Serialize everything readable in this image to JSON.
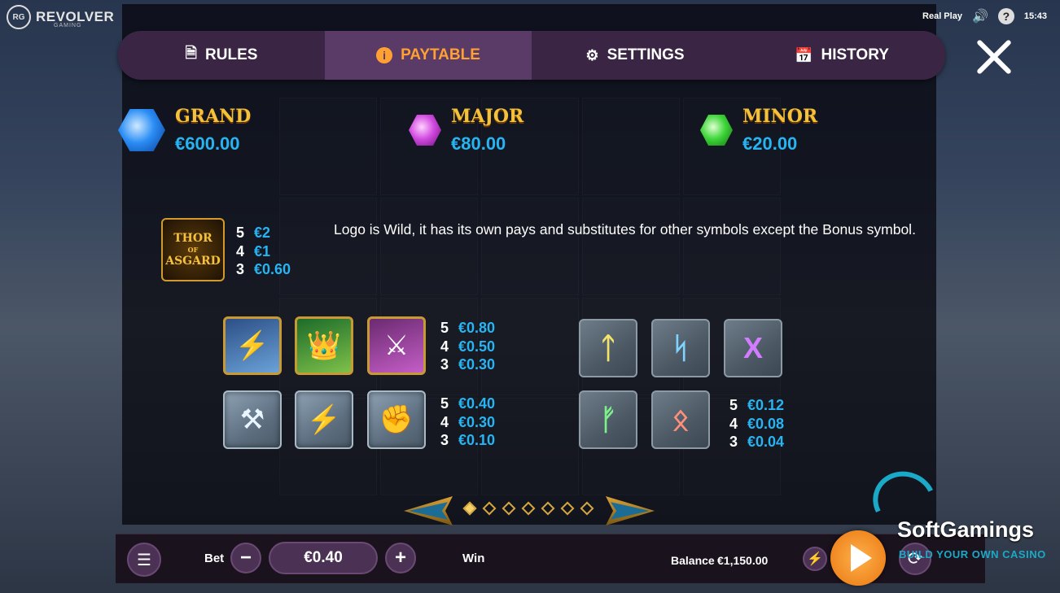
{
  "brand": {
    "logo_mark": "RG",
    "name": "REVOLVER",
    "sub": "GAMING"
  },
  "status": {
    "mode": "Real Play",
    "time": "15:43",
    "help": "?"
  },
  "tabs": [
    {
      "label": "RULES",
      "icon": "document-icon",
      "active": false
    },
    {
      "label": "PAYTABLE",
      "icon": "info-icon",
      "active": true
    },
    {
      "label": "SETTINGS",
      "icon": "gear-icon",
      "active": false
    },
    {
      "label": "HISTORY",
      "icon": "calendar-icon",
      "active": false
    }
  ],
  "jackpots": [
    {
      "name": "GRAND",
      "value": "€600.00",
      "color": "#2a8df5"
    },
    {
      "name": "MAJOR",
      "value": "€80.00",
      "color": "#d24be0"
    },
    {
      "name": "MINOR",
      "value": "€20.00",
      "color": "#3ed63a"
    }
  ],
  "wild": {
    "logo_lines": [
      "THOR",
      "OF",
      "ASGARD"
    ],
    "pays": [
      {
        "count": "5",
        "value": "€2"
      },
      {
        "count": "4",
        "value": "€1"
      },
      {
        "count": "3",
        "value": "€0.60"
      }
    ],
    "description": "Logo is Wild, it has its own pays and substitutes for other symbols except the Bonus symbol."
  },
  "groups": [
    {
      "symbols": [
        "thor-character",
        "loki-character",
        "valkyrie-character"
      ],
      "pays": [
        {
          "count": "5",
          "value": "€0.80"
        },
        {
          "count": "4",
          "value": "€0.50"
        },
        {
          "count": "3",
          "value": "€0.30"
        }
      ]
    },
    {
      "symbols": [
        "hammer-icon",
        "lightning-icon",
        "fist-icon"
      ],
      "pays": [
        {
          "count": "5",
          "value": "€0.40"
        },
        {
          "count": "4",
          "value": "€0.30"
        },
        {
          "count": "3",
          "value": "€0.10"
        }
      ]
    },
    {
      "symbols": [
        "rune-wunjo",
        "rune-sowilo",
        "rune-gebo",
        "rune-fehu",
        "rune-othala"
      ],
      "pays": [
        {
          "count": "5",
          "value": "€0.12"
        },
        {
          "count": "4",
          "value": "€0.08"
        },
        {
          "count": "3",
          "value": "€0.04"
        }
      ]
    }
  ],
  "pagination": {
    "pages": 7,
    "current": 1
  },
  "bottom": {
    "bet_label": "Bet",
    "bet_value": "€0.40",
    "win_label": "Win",
    "balance_label": "Balance",
    "balance_value": "€1,150.00"
  },
  "watermark": {
    "name": "SoftGamings",
    "tagline": "BUILD YOUR OWN CASINO"
  },
  "colors": {
    "accent": "#ffa033",
    "value_blue": "#27b4f2",
    "panel": "#3a2544",
    "gold": "#f5c13a"
  }
}
